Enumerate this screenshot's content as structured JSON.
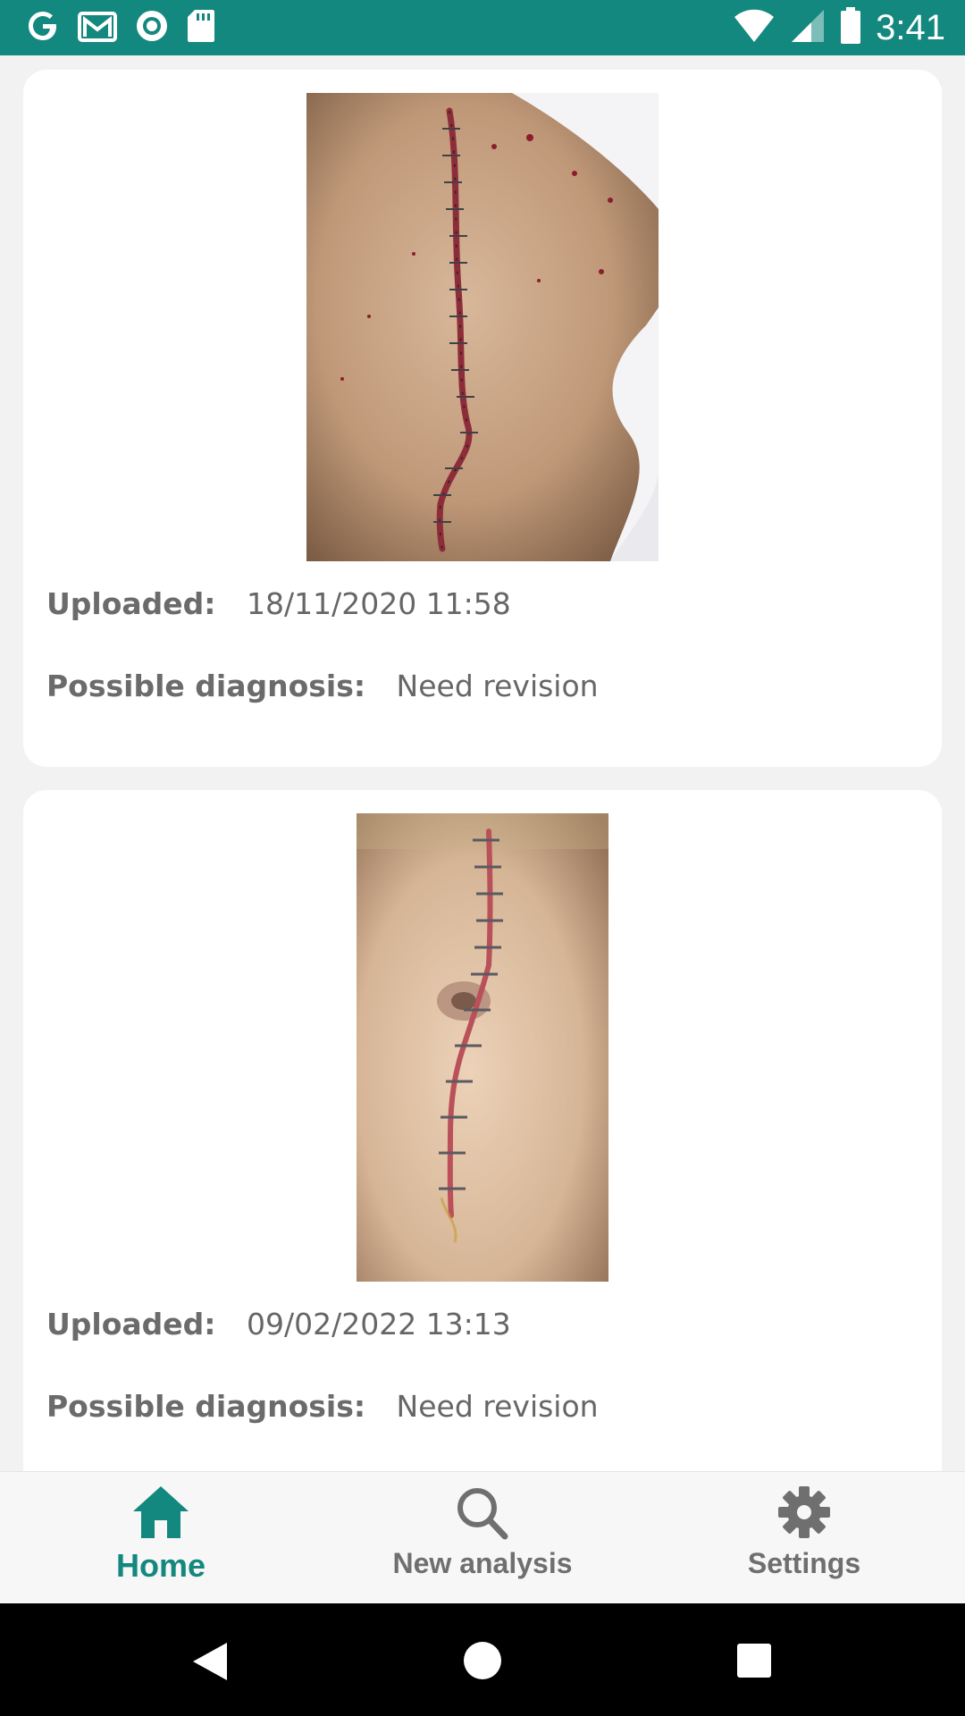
{
  "status_bar": {
    "time": "3:41",
    "notification_icons": [
      "google-g-icon",
      "gmail-icon",
      "circle-app-icon",
      "sd-card-icon"
    ],
    "system_icons": [
      "wifi-icon",
      "signal-icon",
      "battery-icon"
    ],
    "color": "#13887e"
  },
  "cards": [
    {
      "image_alt": "Surgical wound photo",
      "uploaded_label": "Uploaded:",
      "uploaded_value": "18/11/2020 11:58",
      "diagnosis_label": "Possible diagnosis:",
      "diagnosis_value": "Need revision"
    },
    {
      "image_alt": "Surgical wound photo",
      "uploaded_label": "Uploaded:",
      "uploaded_value": "09/02/2022 13:13",
      "diagnosis_label": "Possible diagnosis:",
      "diagnosis_value": "Need revision"
    }
  ],
  "bottom_nav": {
    "items": [
      {
        "label": "Home",
        "icon": "home-icon",
        "active": true
      },
      {
        "label": "New analysis",
        "icon": "search-icon",
        "active": false
      },
      {
        "label": "Settings",
        "icon": "gear-icon",
        "active": false
      }
    ],
    "accent": "#13887e"
  },
  "system_nav": {
    "buttons": [
      "back-icon",
      "home-circle-icon",
      "recents-icon"
    ]
  }
}
